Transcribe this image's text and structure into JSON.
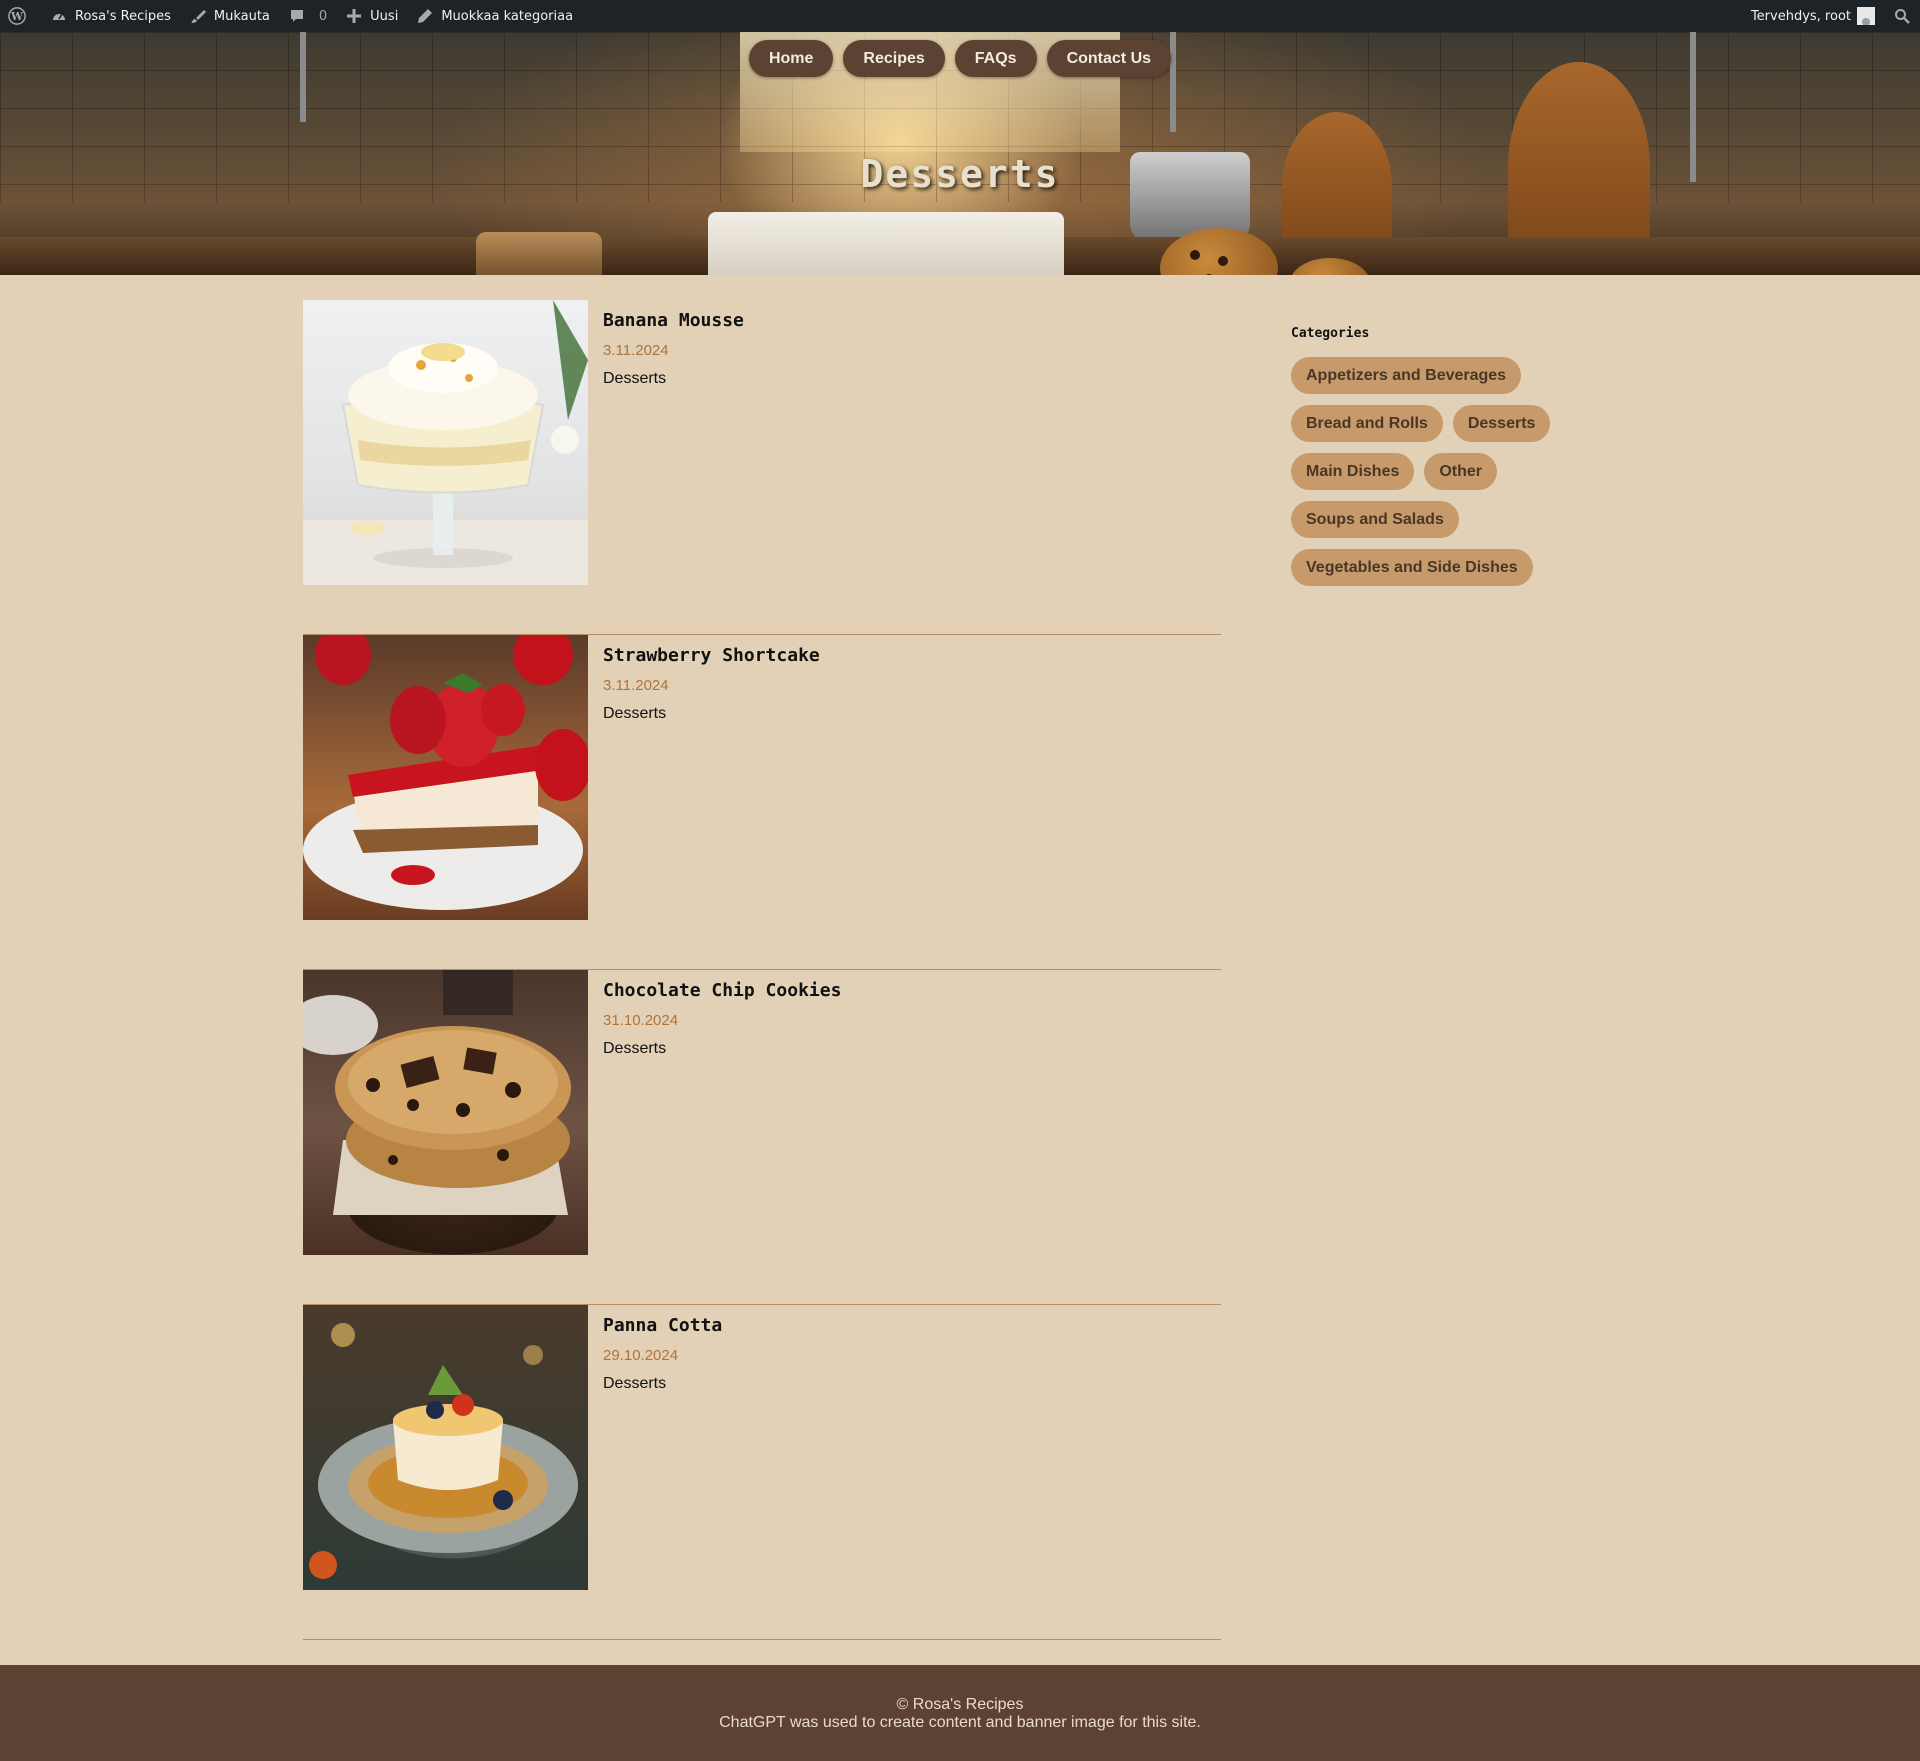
{
  "adminbar": {
    "site_name": "Rosa's Recipes",
    "customize": "Mukauta",
    "comments_count": "0",
    "new": "Uusi",
    "edit_category": "Muokkaa kategoriaa",
    "greeting": "Tervehdys, root"
  },
  "nav": {
    "items": [
      "Home",
      "Recipes",
      "FAQs",
      "Contact Us"
    ]
  },
  "banner": {
    "title": "Desserts"
  },
  "posts": [
    {
      "title": "Banana Mousse",
      "date": "3.11.2024",
      "category": "Desserts",
      "image": "banana-mousse"
    },
    {
      "title": "Strawberry Shortcake",
      "date": "3.11.2024",
      "category": "Desserts",
      "image": "strawberry-shortcake"
    },
    {
      "title": "Chocolate Chip Cookies",
      "date": "31.10.2024",
      "category": "Desserts",
      "image": "chocolate-chip-cookies"
    },
    {
      "title": "Panna Cotta",
      "date": "29.10.2024",
      "category": "Desserts",
      "image": "panna-cotta"
    }
  ],
  "sidebar": {
    "title": "Categories",
    "categories": [
      "Appetizers and Beverages",
      "Bread and Rolls",
      "Desserts",
      "Main Dishes",
      "Other",
      "Soups and Salads",
      "Vegetables and Side Dishes"
    ]
  },
  "footer": {
    "copyright": "© Rosa's Recipes",
    "note": "ChatGPT was used to create content and banner image for this site."
  },
  "colors": {
    "page_bg": "#e2d1b6",
    "accent_brown": "#5c4232",
    "tag_bg": "#c69a6a",
    "date_color": "#b0733a",
    "adminbar_bg": "#1d2327"
  }
}
